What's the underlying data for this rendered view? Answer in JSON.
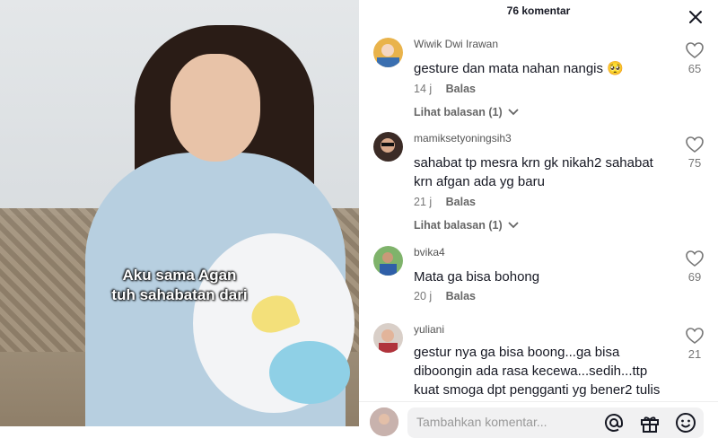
{
  "video": {
    "caption_line1": "Aku sama Agan",
    "caption_line2": "tuh sahabatan dari"
  },
  "panel": {
    "title": "76 komentar",
    "comments": [
      {
        "username": "Wiwik Dwi Irawan",
        "text": "gesture dan mata nahan nangis 🥺",
        "time": "14 j",
        "reply": "Balas",
        "likes": "65",
        "view_replies": "Lihat balasan (1)"
      },
      {
        "username": "mamiksetyoningsih3",
        "text": "sahabat tp mesra krn gk nikah2 sahabat krn afgan ada yg baru",
        "time": "21 j",
        "reply": "Balas",
        "likes": "75",
        "view_replies": "Lihat balasan (1)"
      },
      {
        "username": "bvika4",
        "text": "Mata ga bisa bohong",
        "time": "20 j",
        "reply": "Balas",
        "likes": "69"
      },
      {
        "username": "yuliani",
        "text": "gestur nya ga bisa boong...ga bisa diboongin ada rasa kecewa...sedih...ttp kuat smoga dpt pengganti yg bener2 tulis",
        "likes": "21"
      }
    ],
    "input_placeholder": "Tambahkan komentar..."
  },
  "icons": {
    "close": "close-icon",
    "like": "heart-outline-icon",
    "chevron": "chevron-down-icon",
    "mention": "at-icon",
    "gift": "gift-icon",
    "emoji": "emoji-icon"
  },
  "colors": {
    "text_primary": "#161823",
    "text_secondary": "#777777"
  }
}
